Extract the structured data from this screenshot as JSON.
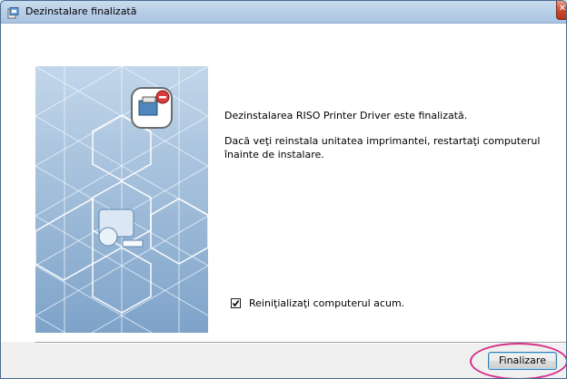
{
  "window": {
    "title": "Dezinstalare finalizată",
    "close_glyph": "✕",
    "title_icon": "installer-icon"
  },
  "content": {
    "message_primary": "Dezinstalarea RISO Printer Driver este finalizată.",
    "message_secondary": "Dacă veţi reinstala unitatea imprimantei, restartaţi computerul înainte de instalare.",
    "restart_checkbox_label": "Reiniţializaţi computerul acum.",
    "restart_checked": true
  },
  "footer": {
    "finish_label": "Finalizare"
  },
  "colors": {
    "highlight": "#d4308b",
    "title_bar": "#b6cde6"
  }
}
